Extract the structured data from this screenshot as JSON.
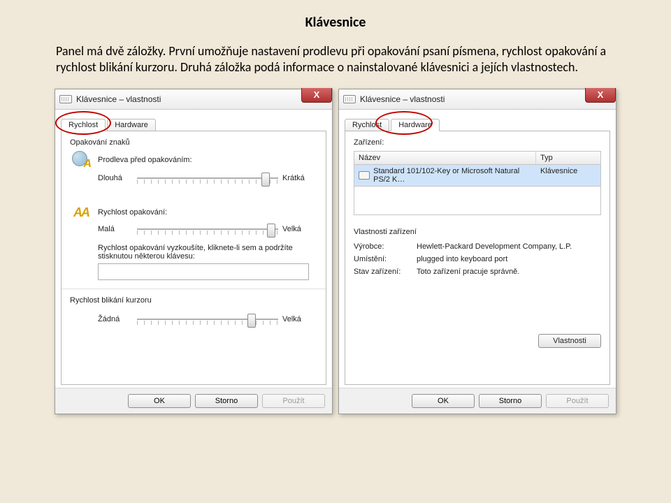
{
  "page": {
    "title": "Klávesnice",
    "intro": "Panel má dvě záložky. První umožňuje nastavení prodlevu při opakování psaní písmena, rychlost opakování a rychlost blikání kurzoru. Druhá záložka podá informace o nainstalované klávesnici a jejích vlastnostech."
  },
  "window": {
    "title": "Klávesnice – vlastnosti",
    "close": "X"
  },
  "tabs": {
    "speed": "Rychlost",
    "hardware": "Hardware"
  },
  "speed_panel": {
    "group_repeat": "Opakování znaků",
    "delay_label": "Prodleva před opakováním:",
    "delay_left": "Dlouhá",
    "delay_right": "Krátká",
    "rate_label": "Rychlost opakování:",
    "rate_left": "Malá",
    "rate_right": "Velká",
    "test_text": "Rychlost opakování vyzkoušíte, kliknete-li sem a podržíte stisknutou některou klávesu:",
    "blink_header": "Rychlost blikání kurzoru",
    "blink_left": "Žádná",
    "blink_right": "Velká"
  },
  "hw_panel": {
    "devices_label": "Zařízení:",
    "col_name": "Název",
    "col_type": "Typ",
    "device_name": "Standard 101/102-Key or Microsoft Natural PS/2 K…",
    "device_type": "Klávesnice",
    "props_header": "Vlastnosti zařízení",
    "manufacturer_k": "Výrobce:",
    "manufacturer_v": "Hewlett-Packard Development Company, L.P.",
    "location_k": "Umístění:",
    "location_v": "plugged into keyboard port",
    "status_k": "Stav zařízení:",
    "status_v": "Toto zařízení pracuje správně.",
    "props_button": "Vlastnosti"
  },
  "footer": {
    "ok": "OK",
    "cancel": "Storno",
    "apply": "Použít"
  }
}
